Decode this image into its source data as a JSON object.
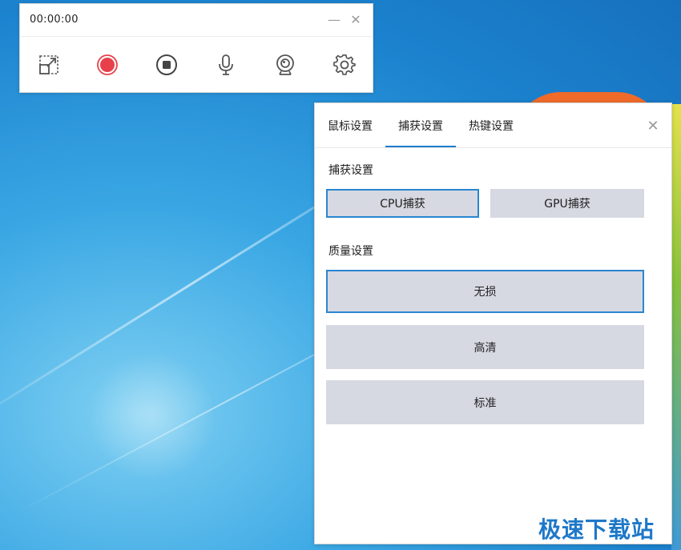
{
  "recorder": {
    "timer": "00:00:00",
    "minimize_glyph": "—",
    "close_glyph": "✕",
    "tools": [
      {
        "name": "region-select-icon"
      },
      {
        "name": "record-icon",
        "color": "#e8404a"
      },
      {
        "name": "stop-icon"
      },
      {
        "name": "microphone-icon"
      },
      {
        "name": "webcam-icon"
      },
      {
        "name": "settings-gear-icon"
      }
    ]
  },
  "settings": {
    "tabs": [
      {
        "label": "鼠标设置"
      },
      {
        "label": "捕获设置"
      },
      {
        "label": "热键设置"
      }
    ],
    "active_tab": "捕获设置",
    "close_glyph": "✕",
    "capture": {
      "label": "捕获设置",
      "options": [
        "CPU捕获",
        "GPU捕获"
      ],
      "selected": "CPU捕获"
    },
    "quality": {
      "label": "质量设置",
      "options": [
        "无损",
        "高清",
        "标准"
      ],
      "selected": "无损"
    }
  },
  "watermark": "极速下载站",
  "colors": {
    "accent": "#2a86d0",
    "button_bg": "#d6d8e2",
    "record_red": "#e8404a"
  }
}
